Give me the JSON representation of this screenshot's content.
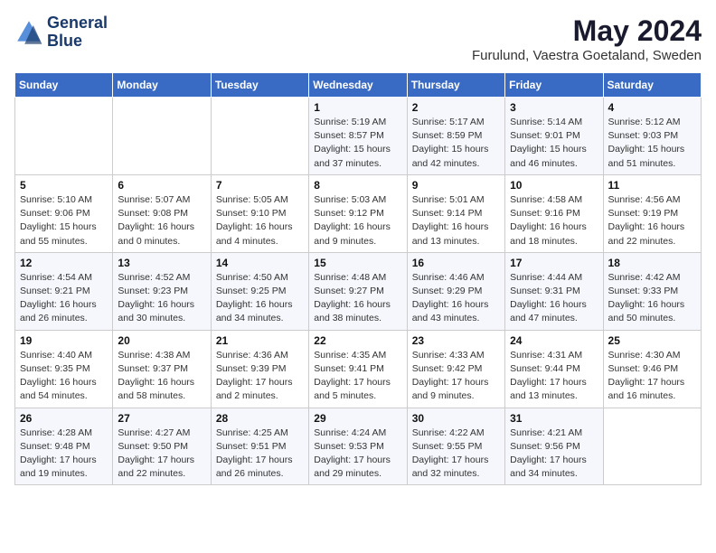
{
  "header": {
    "logo_line1": "General",
    "logo_line2": "Blue",
    "month": "May 2024",
    "location": "Furulund, Vaestra Goetaland, Sweden"
  },
  "weekdays": [
    "Sunday",
    "Monday",
    "Tuesday",
    "Wednesday",
    "Thursday",
    "Friday",
    "Saturday"
  ],
  "weeks": [
    [
      {
        "day": "",
        "info": ""
      },
      {
        "day": "",
        "info": ""
      },
      {
        "day": "",
        "info": ""
      },
      {
        "day": "1",
        "info": "Sunrise: 5:19 AM\nSunset: 8:57 PM\nDaylight: 15 hours and 37 minutes."
      },
      {
        "day": "2",
        "info": "Sunrise: 5:17 AM\nSunset: 8:59 PM\nDaylight: 15 hours and 42 minutes."
      },
      {
        "day": "3",
        "info": "Sunrise: 5:14 AM\nSunset: 9:01 PM\nDaylight: 15 hours and 46 minutes."
      },
      {
        "day": "4",
        "info": "Sunrise: 5:12 AM\nSunset: 9:03 PM\nDaylight: 15 hours and 51 minutes."
      }
    ],
    [
      {
        "day": "5",
        "info": "Sunrise: 5:10 AM\nSunset: 9:06 PM\nDaylight: 15 hours and 55 minutes."
      },
      {
        "day": "6",
        "info": "Sunrise: 5:07 AM\nSunset: 9:08 PM\nDaylight: 16 hours and 0 minutes."
      },
      {
        "day": "7",
        "info": "Sunrise: 5:05 AM\nSunset: 9:10 PM\nDaylight: 16 hours and 4 minutes."
      },
      {
        "day": "8",
        "info": "Sunrise: 5:03 AM\nSunset: 9:12 PM\nDaylight: 16 hours and 9 minutes."
      },
      {
        "day": "9",
        "info": "Sunrise: 5:01 AM\nSunset: 9:14 PM\nDaylight: 16 hours and 13 minutes."
      },
      {
        "day": "10",
        "info": "Sunrise: 4:58 AM\nSunset: 9:16 PM\nDaylight: 16 hours and 18 minutes."
      },
      {
        "day": "11",
        "info": "Sunrise: 4:56 AM\nSunset: 9:19 PM\nDaylight: 16 hours and 22 minutes."
      }
    ],
    [
      {
        "day": "12",
        "info": "Sunrise: 4:54 AM\nSunset: 9:21 PM\nDaylight: 16 hours and 26 minutes."
      },
      {
        "day": "13",
        "info": "Sunrise: 4:52 AM\nSunset: 9:23 PM\nDaylight: 16 hours and 30 minutes."
      },
      {
        "day": "14",
        "info": "Sunrise: 4:50 AM\nSunset: 9:25 PM\nDaylight: 16 hours and 34 minutes."
      },
      {
        "day": "15",
        "info": "Sunrise: 4:48 AM\nSunset: 9:27 PM\nDaylight: 16 hours and 38 minutes."
      },
      {
        "day": "16",
        "info": "Sunrise: 4:46 AM\nSunset: 9:29 PM\nDaylight: 16 hours and 43 minutes."
      },
      {
        "day": "17",
        "info": "Sunrise: 4:44 AM\nSunset: 9:31 PM\nDaylight: 16 hours and 47 minutes."
      },
      {
        "day": "18",
        "info": "Sunrise: 4:42 AM\nSunset: 9:33 PM\nDaylight: 16 hours and 50 minutes."
      }
    ],
    [
      {
        "day": "19",
        "info": "Sunrise: 4:40 AM\nSunset: 9:35 PM\nDaylight: 16 hours and 54 minutes."
      },
      {
        "day": "20",
        "info": "Sunrise: 4:38 AM\nSunset: 9:37 PM\nDaylight: 16 hours and 58 minutes."
      },
      {
        "day": "21",
        "info": "Sunrise: 4:36 AM\nSunset: 9:39 PM\nDaylight: 17 hours and 2 minutes."
      },
      {
        "day": "22",
        "info": "Sunrise: 4:35 AM\nSunset: 9:41 PM\nDaylight: 17 hours and 5 minutes."
      },
      {
        "day": "23",
        "info": "Sunrise: 4:33 AM\nSunset: 9:42 PM\nDaylight: 17 hours and 9 minutes."
      },
      {
        "day": "24",
        "info": "Sunrise: 4:31 AM\nSunset: 9:44 PM\nDaylight: 17 hours and 13 minutes."
      },
      {
        "day": "25",
        "info": "Sunrise: 4:30 AM\nSunset: 9:46 PM\nDaylight: 17 hours and 16 minutes."
      }
    ],
    [
      {
        "day": "26",
        "info": "Sunrise: 4:28 AM\nSunset: 9:48 PM\nDaylight: 17 hours and 19 minutes."
      },
      {
        "day": "27",
        "info": "Sunrise: 4:27 AM\nSunset: 9:50 PM\nDaylight: 17 hours and 22 minutes."
      },
      {
        "day": "28",
        "info": "Sunrise: 4:25 AM\nSunset: 9:51 PM\nDaylight: 17 hours and 26 minutes."
      },
      {
        "day": "29",
        "info": "Sunrise: 4:24 AM\nSunset: 9:53 PM\nDaylight: 17 hours and 29 minutes."
      },
      {
        "day": "30",
        "info": "Sunrise: 4:22 AM\nSunset: 9:55 PM\nDaylight: 17 hours and 32 minutes."
      },
      {
        "day": "31",
        "info": "Sunrise: 4:21 AM\nSunset: 9:56 PM\nDaylight: 17 hours and 34 minutes."
      },
      {
        "day": "",
        "info": ""
      }
    ]
  ]
}
